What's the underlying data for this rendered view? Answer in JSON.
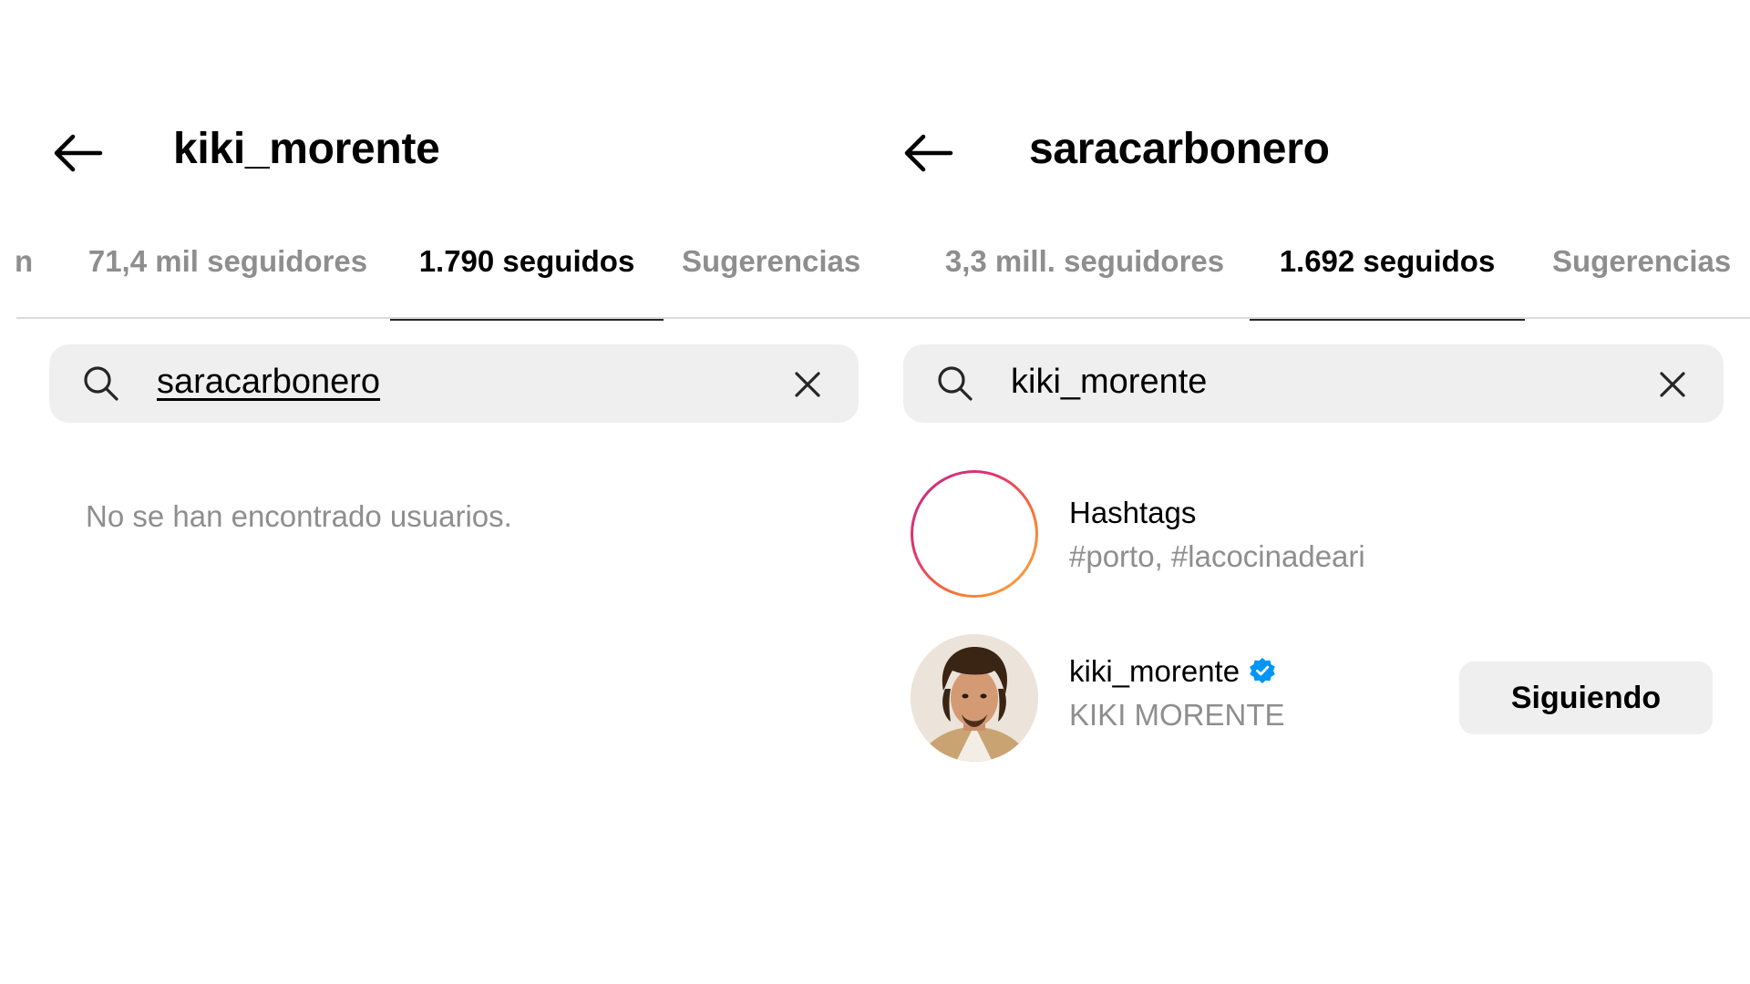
{
  "left_panel": {
    "header": {
      "username": "kiki_morente"
    },
    "tabs": [
      {
        "label": "n"
      },
      {
        "label": "71,4 mil seguidores"
      },
      {
        "label": "1.790 seguidos"
      },
      {
        "label": "Sugerencias"
      }
    ],
    "active_tab": "1.790 seguidos",
    "search": {
      "value": "saracarbonero"
    },
    "empty_message": "No se han encontrado usuarios."
  },
  "right_panel": {
    "header": {
      "username": "saracarbonero"
    },
    "tabs": [
      {
        "label": "3,3 mill. seguidores"
      },
      {
        "label": "1.692 seguidos"
      },
      {
        "label": "Sugerencias"
      }
    ],
    "active_tab": "1.692 seguidos",
    "search": {
      "value": "kiki_morente"
    },
    "results": [
      {
        "type": "hashtag",
        "title": "Hashtags",
        "subtitle": "#porto, #lacocinadeari",
        "icon": "hashtag-icon"
      },
      {
        "type": "user",
        "title": "kiki_morente",
        "subtitle": "KIKI MORENTE",
        "verified": true,
        "button_label": "Siguiendo"
      }
    ]
  },
  "icons": {
    "back": "arrow-left-icon",
    "search": "search-icon",
    "clear": "close-icon",
    "verified": "verified-badge-icon"
  },
  "colors": {
    "active_text": "#000000",
    "inactive_text": "#8e8e8e",
    "search_bg": "#efefef",
    "verified_blue": "#0095f6"
  }
}
